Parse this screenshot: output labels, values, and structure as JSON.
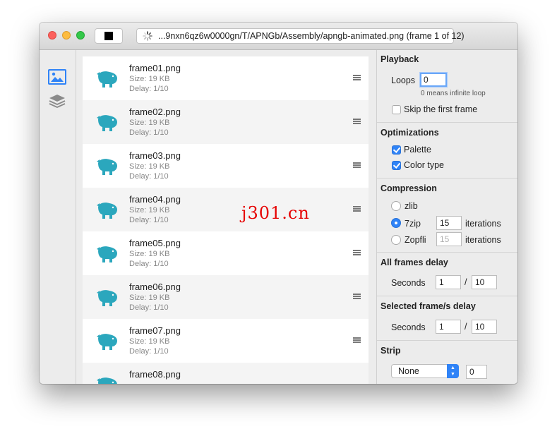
{
  "window": {
    "path": "...9nxn6qz6w0000gn/T/APNGb/Assembly/apngb-animated.png (frame 1 of 12)"
  },
  "sidebar": {
    "items": [
      {
        "icon": "image-icon"
      },
      {
        "icon": "layers-icon"
      }
    ]
  },
  "frames": [
    {
      "name": "frame01.png",
      "size": "Size: 19 KB",
      "delay": "Delay: 1/10"
    },
    {
      "name": "frame02.png",
      "size": "Size: 19 KB",
      "delay": "Delay: 1/10"
    },
    {
      "name": "frame03.png",
      "size": "Size: 19 KB",
      "delay": "Delay: 1/10"
    },
    {
      "name": "frame04.png",
      "size": "Size: 19 KB",
      "delay": "Delay: 1/10"
    },
    {
      "name": "frame05.png",
      "size": "Size: 19 KB",
      "delay": "Delay: 1/10"
    },
    {
      "name": "frame06.png",
      "size": "Size: 19 KB",
      "delay": "Delay: 1/10"
    },
    {
      "name": "frame07.png",
      "size": "Size: 19 KB",
      "delay": "Delay: 1/10"
    },
    {
      "name": "frame08.png",
      "size": "",
      "delay": ""
    }
  ],
  "panel": {
    "playback": {
      "title": "Playback",
      "loops_label": "Loops",
      "loops_value": "0",
      "loops_hint": "0 means infinite loop",
      "skip_label": "Skip the first frame",
      "skip_checked": false
    },
    "optimizations": {
      "title": "Optimizations",
      "palette_label": "Palette",
      "palette_checked": true,
      "colortype_label": "Color type",
      "colortype_checked": true
    },
    "compression": {
      "title": "Compression",
      "zlib_label": "zlib",
      "sevenzip_label": "7zip",
      "sevenzip_iterations": "15",
      "zopfli_label": "Zopfli",
      "zopfli_iterations": "15",
      "iterations_label": "iterations",
      "selected": "7zip"
    },
    "all_delay": {
      "title": "All frames delay",
      "seconds_label": "Seconds",
      "numerator": "1",
      "slash": "/",
      "denominator": "10"
    },
    "selected_delay": {
      "title": "Selected frame/s delay",
      "seconds_label": "Seconds",
      "numerator": "1",
      "slash": "/",
      "denominator": "10"
    },
    "strip": {
      "title": "Strip",
      "option": "None",
      "count": "0"
    }
  },
  "watermark": "j301.cn",
  "colors": {
    "accent": "#2f83f7",
    "thumbnail": "#2ba7bd",
    "watermark": "#e60000"
  }
}
